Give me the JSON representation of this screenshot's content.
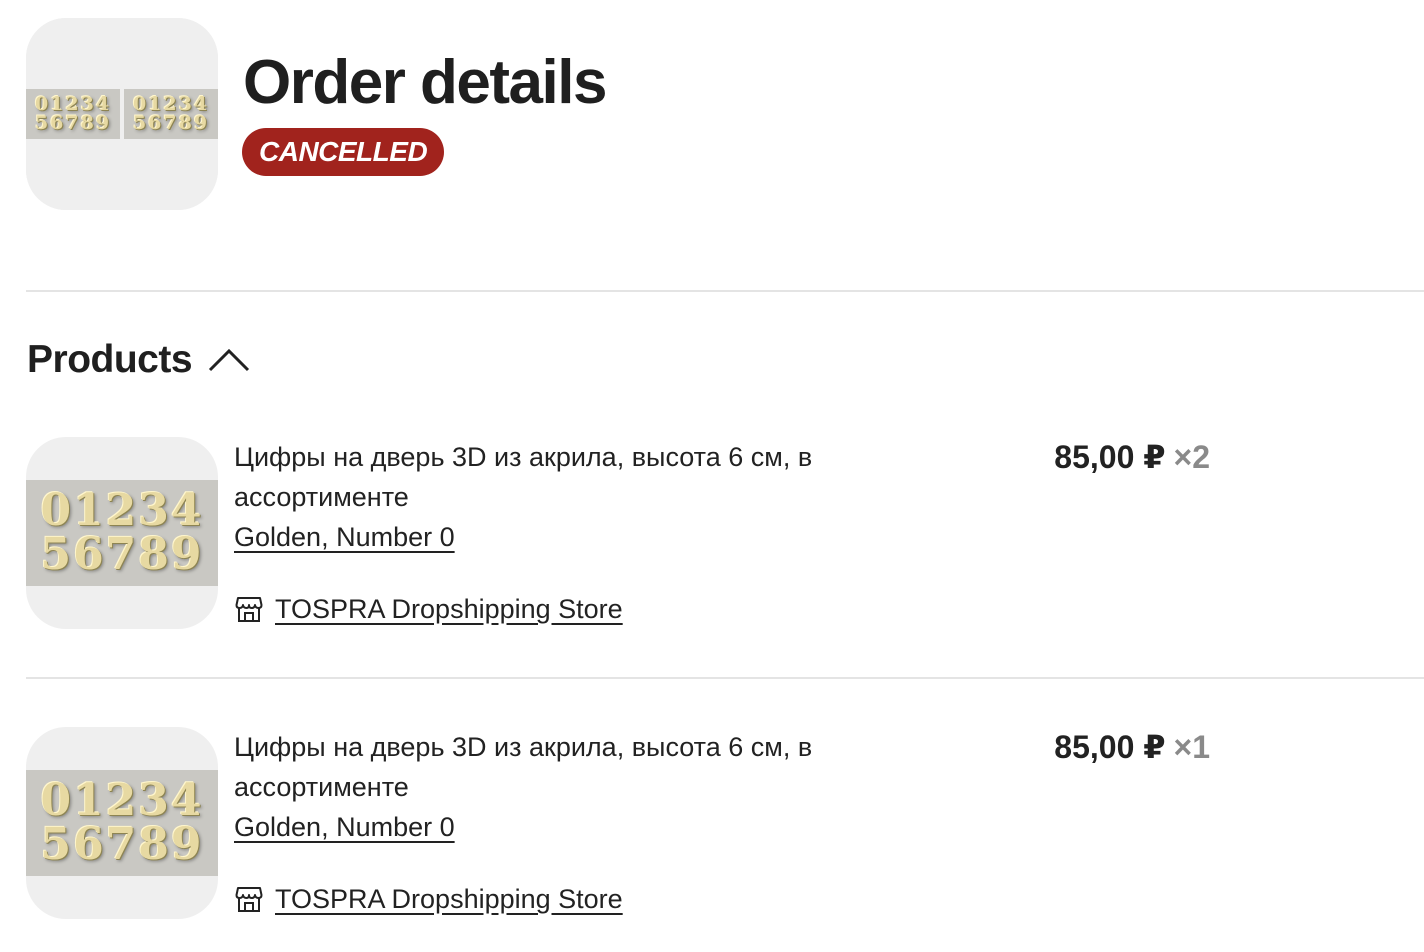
{
  "header": {
    "title": "Order details",
    "status": "CANCELLED",
    "thumbnail_icon": "order-products-collage"
  },
  "products": {
    "title": "Products",
    "toggle_icon": "chevron-up-icon",
    "items": [
      {
        "name": "Цифры на дверь 3D из акрила, высота 6 см, в ассортименте",
        "variant": "Golden, Number 0",
        "store": "TOSPRA Dropshipping Store",
        "price": "85,00 ₽",
        "quantity": "×2",
        "image_digits_top": "01234",
        "image_digits_bottom": "56789"
      },
      {
        "name": "Цифры на дверь 3D из акрила, высота 6 см, в ассортименте",
        "variant": "Golden, Number 0",
        "store": "TOSPRA Dropshipping Store",
        "price": "85,00 ₽",
        "quantity": "×1",
        "image_digits_top": "01234",
        "image_digits_bottom": "56789"
      }
    ]
  },
  "colors": {
    "status_badge": "#a1231d",
    "divider": "#e4e4e4",
    "quantity_text": "#8a8a8a"
  }
}
